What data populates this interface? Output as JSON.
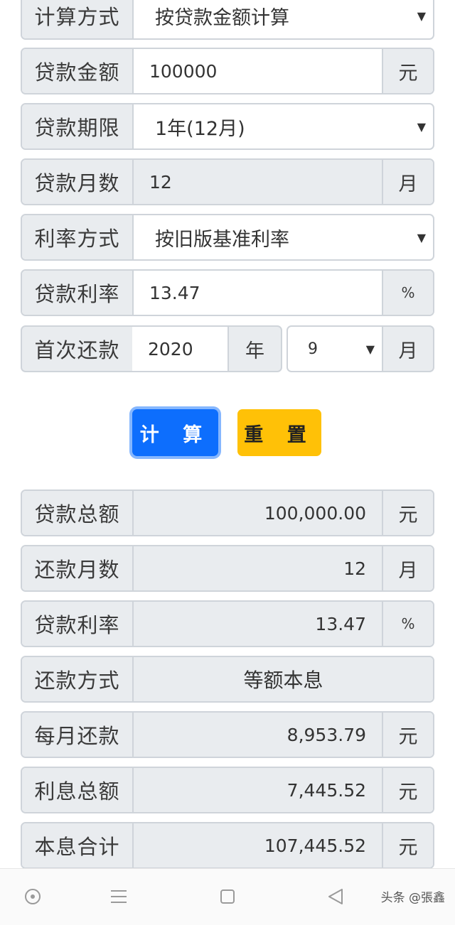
{
  "form": {
    "calc_method": {
      "label": "计算方式",
      "value": "按贷款金额计算"
    },
    "loan_amount": {
      "label": "贷款金额",
      "value": "100000",
      "unit": "元"
    },
    "loan_term": {
      "label": "贷款期限",
      "value": "1年(12月)"
    },
    "loan_months": {
      "label": "贷款月数",
      "value": "12",
      "unit": "月"
    },
    "rate_method": {
      "label": "利率方式",
      "value": "按旧版基准利率"
    },
    "loan_rate": {
      "label": "贷款利率",
      "value": "13.47",
      "unit": "%"
    },
    "first_repay": {
      "label": "首次还款",
      "year": "2020",
      "year_unit": "年",
      "month": "9",
      "month_unit": "月"
    }
  },
  "buttons": {
    "calculate": "计 算",
    "reset": "重 置"
  },
  "results": {
    "total_loan": {
      "label": "贷款总额",
      "value": "100,000.00",
      "unit": "元"
    },
    "repay_months": {
      "label": "还款月数",
      "value": "12",
      "unit": "月"
    },
    "rate": {
      "label": "贷款利率",
      "value": "13.47",
      "unit": "%"
    },
    "repay_method": {
      "label": "还款方式",
      "value": "等额本息"
    },
    "monthly_payment": {
      "label": "每月还款",
      "value": "8,953.79",
      "unit": "元"
    },
    "total_interest": {
      "label": "利息总额",
      "value": "7,445.52",
      "unit": "元"
    },
    "total_sum": {
      "label": "本息合计",
      "value": "107,445.52",
      "unit": "元"
    }
  },
  "navbar": {
    "icons": [
      "circle-dot-icon",
      "menu-icon",
      "square-icon",
      "back-triangle-icon"
    ],
    "watermark": "头条 @張鑫"
  },
  "colors": {
    "primary": "#0d6efd",
    "warning": "#ffc107",
    "label_bg": "#e9ecef",
    "border": "#cfd4da"
  }
}
